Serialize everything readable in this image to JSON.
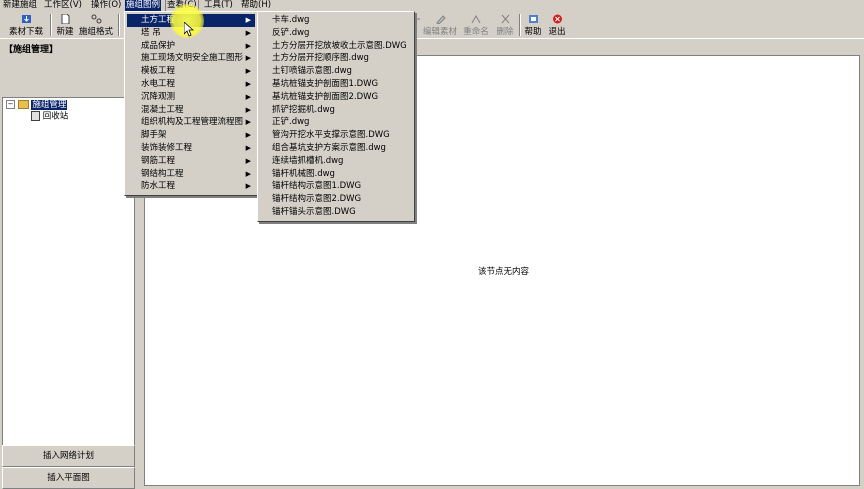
{
  "menubar": {
    "items": [
      "新建施组",
      "工作区(V)",
      "操作(O)",
      "施组图例",
      "查看(C)",
      "工具(T)",
      "帮助(H)"
    ]
  },
  "toolbar": {
    "download": "素材下载",
    "new": "新建",
    "format": "施组格式",
    "edit_material": "编辑素材",
    "rename": "重命名",
    "delete": "删除",
    "help": "帮助",
    "exit": "退出"
  },
  "left_panel": {
    "title": "【施组管理】",
    "tree": {
      "root": "施组管理",
      "child": "回收站"
    },
    "btn_network": "插入网络计划",
    "btn_plan": "插入平面图"
  },
  "main": {
    "empty_message": "该节点无内容"
  },
  "legend_menu": {
    "items": [
      "土方工程",
      "塔 吊",
      "成品保护",
      "施工现场文明安全施工图形",
      "模板工程",
      "水电工程",
      "沉降观测",
      "混凝土工程",
      "组织机构及工程管理流程图",
      "脚手架",
      "装饰装修工程",
      "钢筋工程",
      "钢结构工程",
      "防水工程"
    ]
  },
  "earthwork_submenu": {
    "items": [
      "卡车.dwg",
      "反铲.dwg",
      "土方分层开挖放坡收土示意图.DWG",
      "土方分层开挖顺序图.dwg",
      "土钉喷锚示意图.dwg",
      "基坑桩锚支护剖面图1.DWG",
      "基坑桩锚支护剖面图2.DWG",
      "抓铲挖掘机.dwg",
      "正铲.dwg",
      "管沟开挖水平支撑示意图.DWG",
      "组合基坑支护方案示意图.dwg",
      "连续墙抓槽机.dwg",
      "锚杆机械图.dwg",
      "锚杆结构示意图1.DWG",
      "锚杆结构示意图2.DWG",
      "锚杆锚头示意图.DWG"
    ]
  },
  "colors": {
    "chrome": "#d4d0c8",
    "highlight": "#0a246a",
    "cursor": "#ffff40"
  }
}
